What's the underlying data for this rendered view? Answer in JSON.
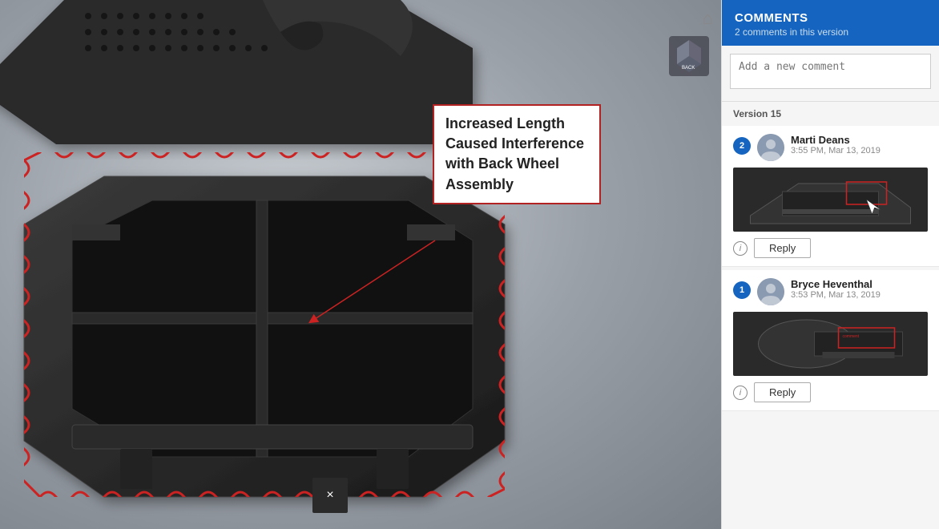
{
  "viewport": {
    "close_btn_label": "×"
  },
  "panel": {
    "header_title": "COMMENTS",
    "header_subtitle": "2 comments in this version",
    "new_comment_placeholder": "Add a new comment",
    "version_label": "Version 15"
  },
  "annotation": {
    "text": "Increased Length Caused Interference with Back Wheel Assembly"
  },
  "comments": [
    {
      "id": 2,
      "author": "Marti Deans",
      "time": "3:55 PM, Mar 13, 2019",
      "reply_label": "Reply"
    },
    {
      "id": 1,
      "author": "Bryce Heventhal",
      "time": "3:53 PM, Mar 13, 2019",
      "reply_label": "Reply"
    }
  ],
  "icons": {
    "home": "⌂",
    "close": "×",
    "info": "i"
  }
}
